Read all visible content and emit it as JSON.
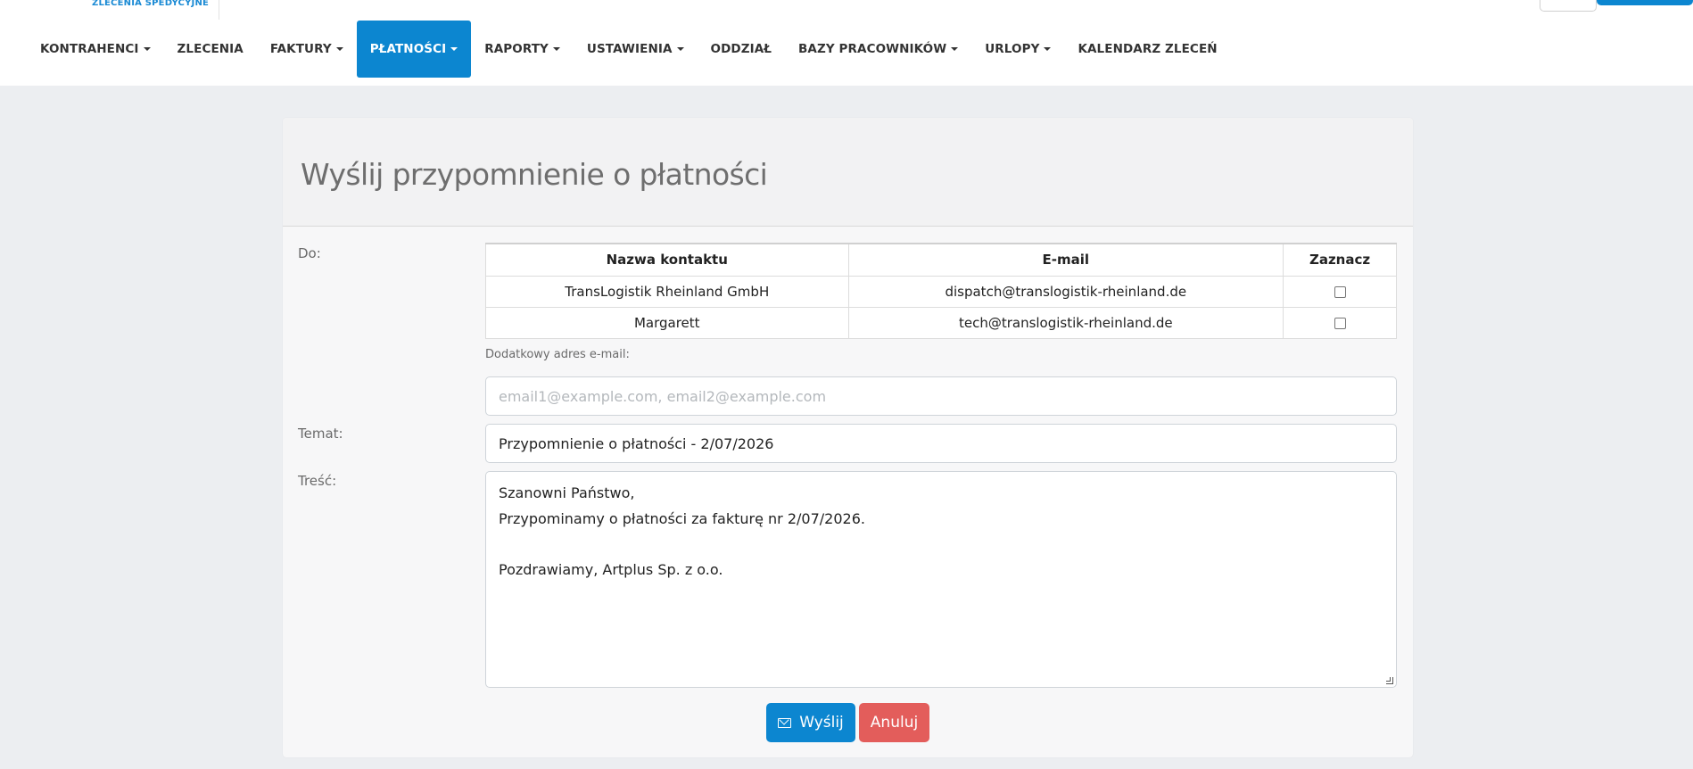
{
  "header": {
    "brand_text": "ZLECENIA SPEDYCYJNE",
    "nav": [
      {
        "label": "KONTRAHENCI",
        "dropdown": true,
        "active": false
      },
      {
        "label": "ZLECENIA",
        "dropdown": false,
        "active": false
      },
      {
        "label": "FAKTURY",
        "dropdown": true,
        "active": false
      },
      {
        "label": "PŁATNOŚCI",
        "dropdown": true,
        "active": true
      },
      {
        "label": "RAPORTY",
        "dropdown": true,
        "active": false
      },
      {
        "label": "USTAWIENIA",
        "dropdown": true,
        "active": false
      },
      {
        "label": "ODDZIAŁ",
        "dropdown": false,
        "active": false
      },
      {
        "label": "BAZY PRACOWNIKÓW",
        "dropdown": true,
        "active": false
      },
      {
        "label": "URLOPY",
        "dropdown": true,
        "active": false
      },
      {
        "label": "KALENDARZ ZLECEŃ",
        "dropdown": false,
        "active": false
      }
    ]
  },
  "form": {
    "title": "Wyślij przypomnienie o płatności",
    "to_label": "Do:",
    "table": {
      "headers": [
        "Nazwa kontaktu",
        "E-mail",
        "Zaznacz"
      ],
      "rows": [
        {
          "name": "TransLogistik Rheinland GmbH",
          "email": "dispatch@translogistik-rheinland.de",
          "checked": false
        },
        {
          "name": "Margarett",
          "email": "tech@translogistik-rheinland.de",
          "checked": false
        }
      ]
    },
    "extra_email_label": "Dodatkowy adres e-mail:",
    "extra_email_placeholder": "email1@example.com, email2@example.com",
    "subject_label": "Temat:",
    "subject_value": "Przypomnienie o płatności - 2/07/2026",
    "body_label": "Treść:",
    "body_lines": [
      "Szanowni Państwo,",
      "Przypominamy o płatności za fakturę nr 2/07/2026.",
      "",
      "Pozdrawiamy, Artplus Sp. z o.o."
    ],
    "send_label": "Wyślij",
    "cancel_label": "Anuluj"
  },
  "colors": {
    "accent": "#0c86d0",
    "danger": "#e35d5b",
    "page_bg": "#eceef1"
  }
}
